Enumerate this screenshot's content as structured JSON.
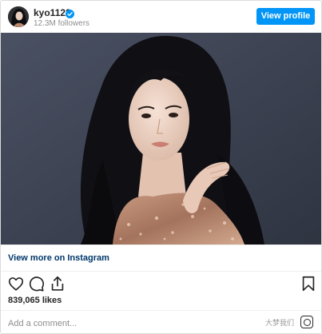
{
  "post": {
    "username": "kyo1122",
    "followers": "12.3M followers",
    "view_profile_label": "View profile",
    "view_more_label": "View more on Instagram",
    "likes": "839,065 likes",
    "comment_placeholder": "Add a comment...",
    "watermark": "大梦我们"
  },
  "colors": {
    "accent": "#0095f6",
    "link": "#00376b",
    "photo_background": "#3a4150"
  },
  "icons": {
    "like": "heart-icon",
    "comment": "comment-icon",
    "share": "share-icon",
    "save": "bookmark-icon",
    "verified": "verified-badge-icon",
    "instagram": "instagram-icon"
  }
}
